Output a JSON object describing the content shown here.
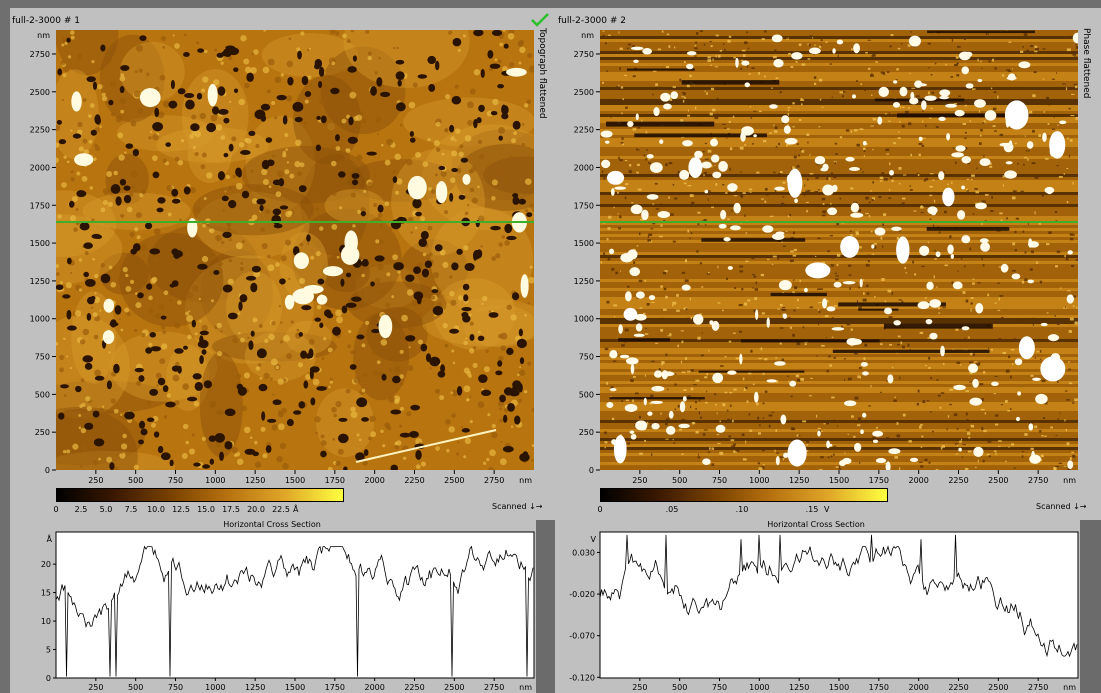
{
  "panels": [
    {
      "title": "full-2-3000 # 1",
      "side_label": "Topograph flattened",
      "check_icon": "check-icon",
      "y_unit": "nm",
      "y_ticks": [
        "2750",
        "2500",
        "2250",
        "2000",
        "1750",
        "1500",
        "1250",
        "1000",
        "750",
        "500",
        "250",
        "0"
      ],
      "x_ticks": [
        "250",
        "500",
        "750",
        "1000",
        "1250",
        "1500",
        "1750",
        "2000",
        "2250",
        "2500",
        "2750"
      ],
      "x_unit": "nm",
      "scale_ticks": [
        "0",
        "2.5",
        "5.0",
        "7.5",
        "10.0",
        "12.5",
        "15.0",
        "17.5",
        "20.0",
        "22.5"
      ],
      "scale_unit": "Å",
      "scanned_label": "Scanned ↓→",
      "cross_section": {
        "title": "Horizontal Cross Section",
        "y_unit": "Å",
        "y_ticks": [
          "20",
          "15",
          "10",
          "5",
          "0"
        ],
        "x_ticks": [
          "250",
          "500",
          "750",
          "1000",
          "1250",
          "1500",
          "1750",
          "2000",
          "2250",
          "2500",
          "2750"
        ],
        "x_unit": "nm"
      }
    },
    {
      "title": "full-2-3000 # 2",
      "side_label": "Phase flattened",
      "y_unit": "nm",
      "y_ticks": [
        "2750",
        "2500",
        "2250",
        "2000",
        "1750",
        "1500",
        "1250",
        "1000",
        "750",
        "500",
        "250",
        "0"
      ],
      "x_ticks": [
        "250",
        "500",
        "750",
        "1000",
        "1250",
        "1500",
        "1750",
        "2000",
        "2250",
        "2500",
        "2750"
      ],
      "x_unit": "nm",
      "scale_ticks": [
        "0",
        ".05",
        ".10",
        ".15"
      ],
      "scale_unit": "V",
      "scanned_label": "Scanned ↓→",
      "cross_section": {
        "title": "Horizontal Cross Section",
        "y_unit": "V",
        "y_ticks": [
          "0.030",
          "-0.020",
          "-0.070",
          "-0.120"
        ],
        "x_ticks": [
          "250",
          "500",
          "750",
          "1000",
          "1250",
          "1500",
          "1750",
          "2000",
          "2250",
          "2500",
          "2750"
        ],
        "x_unit": "nm"
      }
    }
  ],
  "colors": {
    "background": "#c0c0c0",
    "frame": "#6f6f6f",
    "afm_dark": "#5a3406",
    "afm_mid": "#b8740f",
    "afm_light": "#f2d060",
    "cursor_line": "#3fae2a",
    "check": "#2bbf2b"
  }
}
